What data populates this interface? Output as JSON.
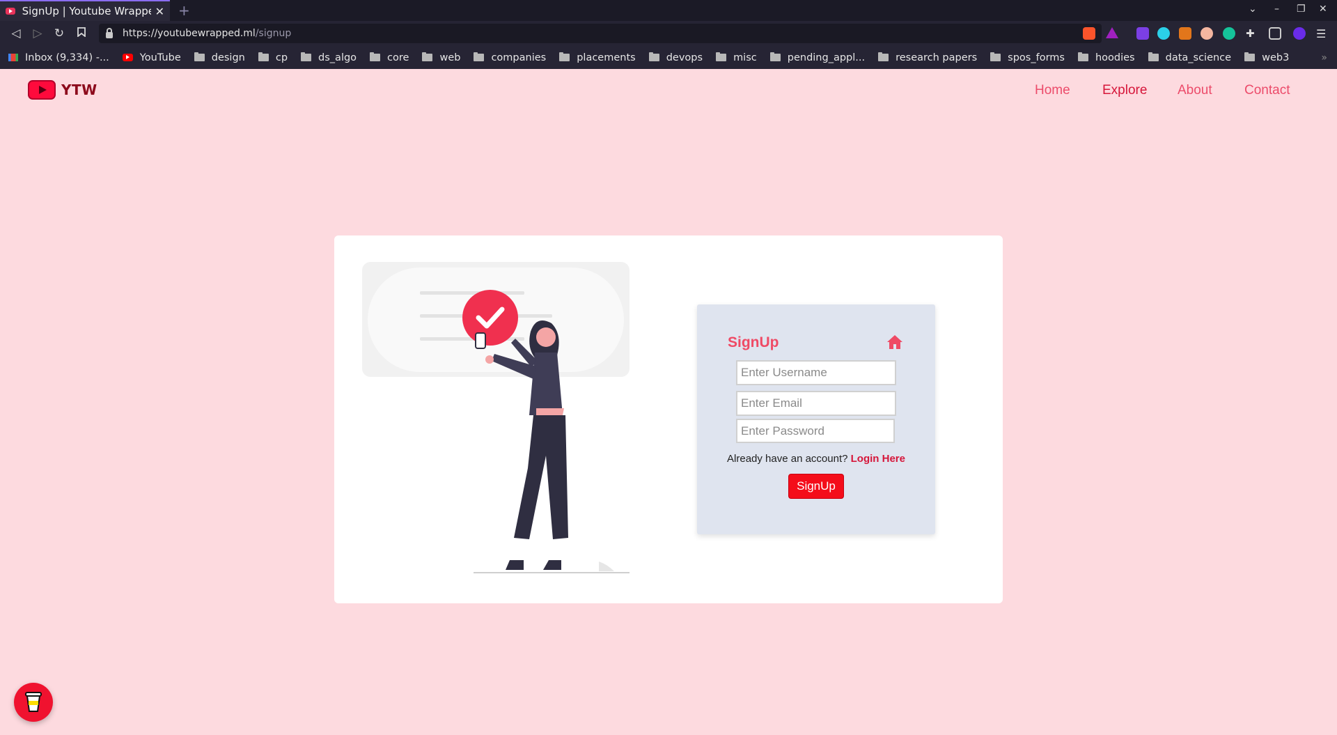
{
  "browser": {
    "tab_title": "SignUp | Youtube Wrappe",
    "url_host": "https://youtubewrapped.ml",
    "url_path": "/signup",
    "bookmarks": [
      {
        "label": "Inbox (9,334) -...",
        "icon": "gmail-icon"
      },
      {
        "label": "YouTube",
        "icon": "youtube-icon"
      },
      {
        "label": "design",
        "icon": "folder-icon"
      },
      {
        "label": "cp",
        "icon": "folder-icon"
      },
      {
        "label": "ds_algo",
        "icon": "folder-icon"
      },
      {
        "label": "core",
        "icon": "folder-icon"
      },
      {
        "label": "web",
        "icon": "folder-icon"
      },
      {
        "label": "companies",
        "icon": "folder-icon"
      },
      {
        "label": "placements",
        "icon": "folder-icon"
      },
      {
        "label": "devops",
        "icon": "folder-icon"
      },
      {
        "label": "misc",
        "icon": "folder-icon"
      },
      {
        "label": "pending_appl...",
        "icon": "folder-icon"
      },
      {
        "label": "research papers",
        "icon": "folder-icon"
      },
      {
        "label": "spos_forms",
        "icon": "folder-icon"
      },
      {
        "label": "hoodies",
        "icon": "folder-icon"
      },
      {
        "label": "data_science",
        "icon": "folder-icon"
      },
      {
        "label": "web3",
        "icon": "folder-icon"
      }
    ]
  },
  "site": {
    "brand": "YTW",
    "nav": {
      "home": "Home",
      "explore": "Explore",
      "about": "About",
      "contact": "Contact"
    }
  },
  "signup": {
    "title": "SignUp",
    "username_placeholder": "Enter Username",
    "email_placeholder": "Enter Email",
    "password_placeholder": "Enter Password",
    "already_text": "Already have an account?",
    "login_link": "Login Here",
    "submit_label": "SignUp"
  },
  "colors": {
    "page_bg": "#fddadf",
    "accent": "#ef4a65",
    "button": "#f40d1a",
    "box_bg": "#dfe4ef"
  }
}
